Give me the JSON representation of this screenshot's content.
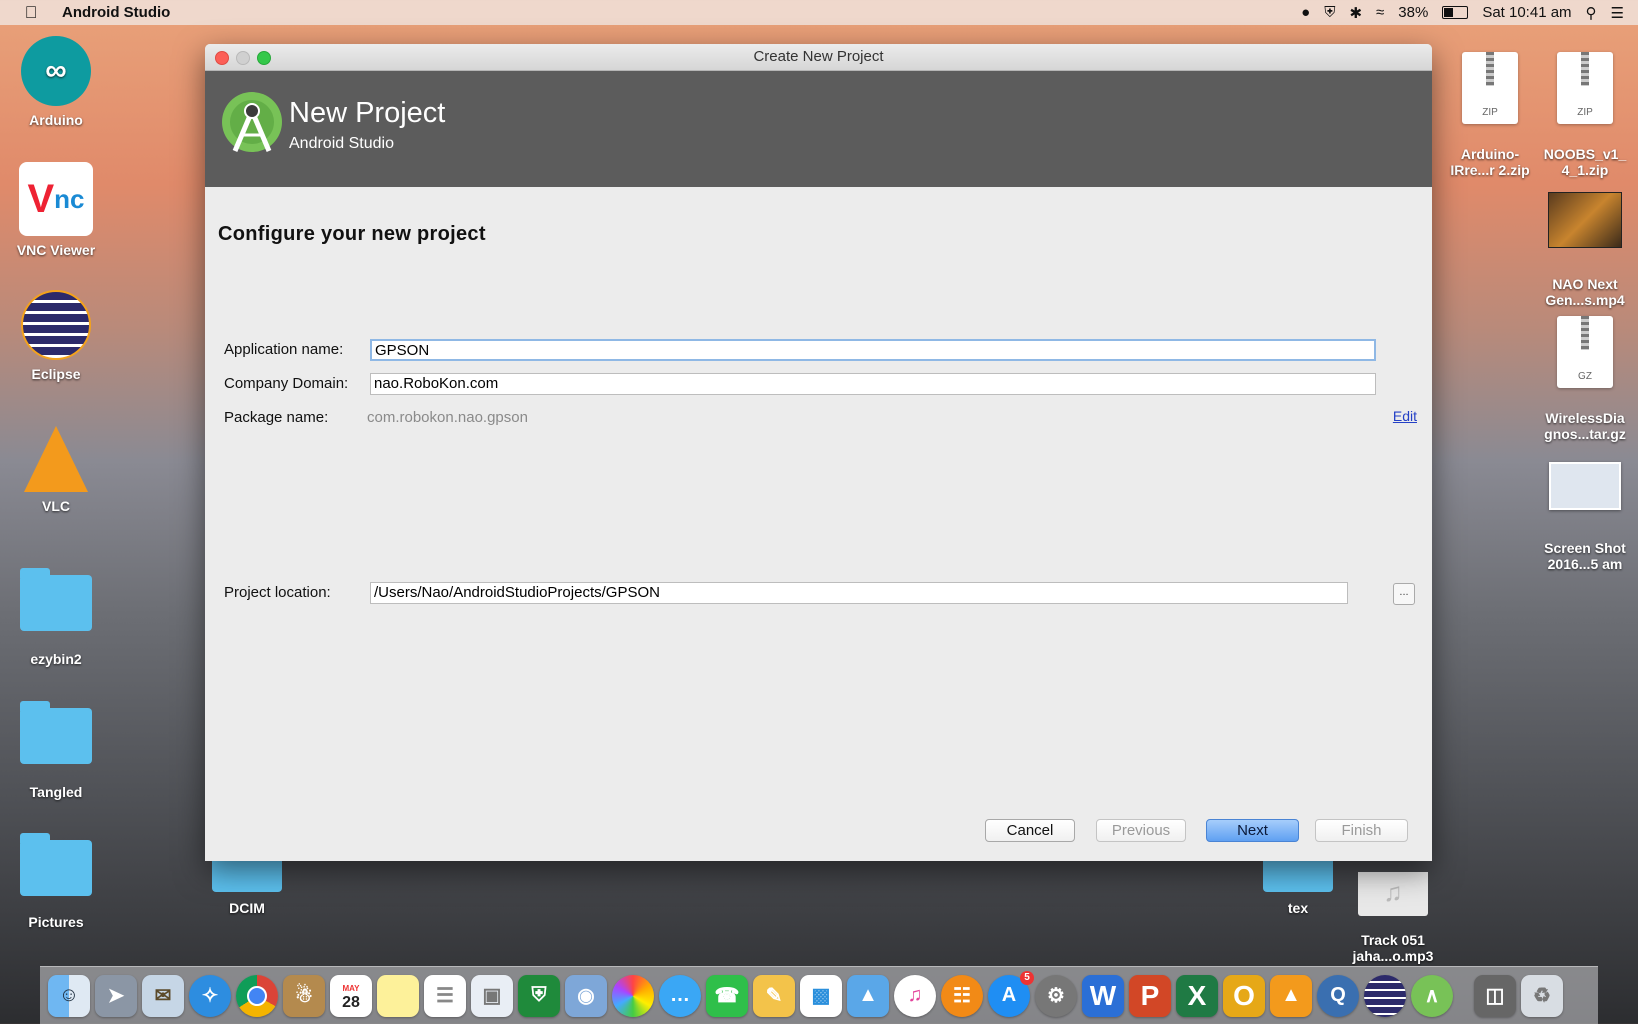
{
  "menubar": {
    "app_name": "Android Studio",
    "battery": "38%",
    "clock": "Sat 10:41 am"
  },
  "desktop": {
    "left_icons": [
      {
        "label": "Arduino"
      },
      {
        "label": "VNC Viewer"
      },
      {
        "label": "Eclipse"
      },
      {
        "label": "VLC"
      },
      {
        "label": "ezybin2"
      },
      {
        "label": "Tangled"
      },
      {
        "label": "Pictures"
      }
    ],
    "right_icons": [
      {
        "label": "Arduino-\nIRre...r 2.zip",
        "badge": "ZIP"
      },
      {
        "label": "NOOBS_v1_\n4_1.zip",
        "badge": "ZIP"
      },
      {
        "label": "NAO Next\nGen...s.mp4"
      },
      {
        "label": "WirelessDia\ngnos...tar.gz",
        "badge": "GZ"
      },
      {
        "label": "Screen Shot\n2016...5 am"
      }
    ],
    "bottom_icons": [
      {
        "label": "DCIM"
      },
      {
        "label": "tex"
      },
      {
        "label": "Track 051\njaha...o.mp3"
      }
    ]
  },
  "window": {
    "title": "Create New Project",
    "header_title": "New Project",
    "header_subtitle": "Android Studio",
    "heading": "Configure your new project",
    "app_name_label": "Application name:",
    "app_name_value": "GPSON",
    "domain_label": "Company Domain:",
    "domain_value": "nao.RoboKon.com",
    "package_label": "Package name:",
    "package_value": "com.robokon.nao.gpson",
    "edit_link": "Edit",
    "location_label": "Project location:",
    "location_value": "/Users/Nao/AndroidStudioProjects/GPSON",
    "browse_label": "...",
    "buttons": {
      "cancel": "Cancel",
      "previous": "Previous",
      "next": "Next",
      "finish": "Finish"
    }
  },
  "dock": {
    "calendar_month": "MAY",
    "calendar_day": "28",
    "appstore_badge": "5"
  }
}
